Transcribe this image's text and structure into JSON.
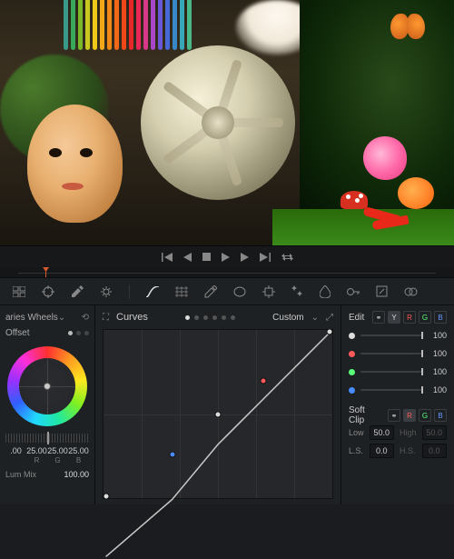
{
  "transport": {
    "buttons": [
      "first-frame",
      "prev-frame",
      "stop",
      "play",
      "next-frame",
      "last-frame",
      "loop"
    ]
  },
  "toolbar": {
    "tools": [
      "selector",
      "tracker",
      "eyedropper",
      "balance",
      "curves-mode",
      "warper",
      "scopes",
      "mask",
      "magic",
      "effects",
      "keyframes",
      "stereo"
    ]
  },
  "primaries": {
    "panel_label": "aries Wheels",
    "wheel_label": "Offset",
    "values": {
      "r": "25.00",
      "g": "25.00",
      "b": "25.00",
      "val": ".00"
    },
    "labels": {
      "r": "R",
      "g": "G",
      "b": "B"
    },
    "lum_mix_label": "Lum Mix",
    "lum_mix_value": "100.00"
  },
  "curves": {
    "title": "Curves",
    "mode_label": "Custom",
    "edit_label": "Edit",
    "channels": {
      "y": "Y",
      "r": "R",
      "g": "G",
      "b": "B",
      "linked": "⚭"
    },
    "chart_data": {
      "type": "line",
      "curve": "custom-luma",
      "domain": [
        0,
        1
      ],
      "range": [
        0,
        1
      ],
      "grid": {
        "v": 6,
        "h": 2
      },
      "points": [
        {
          "x": 0.0,
          "y": 0.0,
          "color": "#dddddd"
        },
        {
          "x": 0.3,
          "y": 0.26,
          "color": "#4a8aff"
        },
        {
          "x": 0.5,
          "y": 0.5,
          "color": "#dddddd"
        },
        {
          "x": 0.7,
          "y": 0.7,
          "color": "#ff5a5a"
        },
        {
          "x": 1.0,
          "y": 1.0,
          "color": "#dddddd"
        }
      ]
    },
    "edit_sliders": [
      {
        "color": "#dddddd",
        "value": "100"
      },
      {
        "color": "#ff5a5a",
        "value": "100"
      },
      {
        "color": "#5aff7a",
        "value": "100"
      },
      {
        "color": "#4a8aff",
        "value": "100"
      }
    ],
    "softclip": {
      "title": "Soft Clip",
      "low_label": "Low",
      "low_value": "50.0",
      "high_label": "High",
      "high_value": "50.0",
      "ls_label": "L.S.",
      "ls_value": "0.0",
      "hs_label": "H.S.",
      "hs_value": "0.0"
    }
  }
}
